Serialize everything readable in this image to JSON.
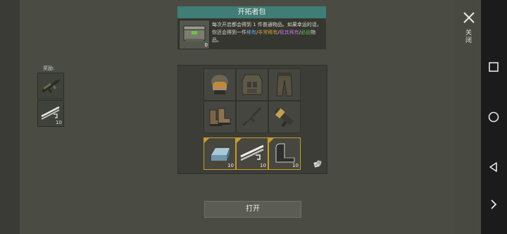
{
  "pack": {
    "title": "开拓者包",
    "count": "0",
    "desc": {
      "p1": "每次开启都会得到 1 件普通物品。如果幸运的话，你还会得到一件",
      "rare": "稀有",
      "sep1": "/",
      "very_rare": "非常稀有",
      "sep2": "/",
      "epic": "极其稀有",
      "sep3": "/",
      "guaranteed": "必出",
      "tail": "物品。"
    }
  },
  "rewards": {
    "label": "奖励:",
    "items": [
      {
        "icon": "rifle-icon",
        "qty": ""
      },
      {
        "icon": "pipes-icon",
        "qty": "10"
      }
    ]
  },
  "grid": {
    "rows": [
      [
        {
          "icon": "helmet-icon",
          "qty": ""
        },
        {
          "icon": "vest-icon",
          "qty": ""
        },
        {
          "icon": "pants-icon",
          "qty": ""
        }
      ],
      [
        {
          "icon": "boots-icon",
          "qty": ""
        },
        {
          "icon": "rifle-icon",
          "qty": ""
        },
        {
          "icon": "launcher-icon",
          "qty": ""
        }
      ],
      [
        {
          "icon": "metal-ingot-icon",
          "qty": "10"
        },
        {
          "icon": "pipes-icon",
          "qty": "10"
        },
        {
          "icon": "metal-sheet-icon",
          "qty": "10"
        }
      ]
    ]
  },
  "open_button": "打开",
  "close_label": "关闭",
  "colors": {
    "title_bar": "#3f7d76",
    "bonus_border": "#c89a2c",
    "rare": "#6aa3e6",
    "very_rare": "#c69a3e",
    "epic": "#b36fd8",
    "guaranteed": "#6cc35c"
  }
}
